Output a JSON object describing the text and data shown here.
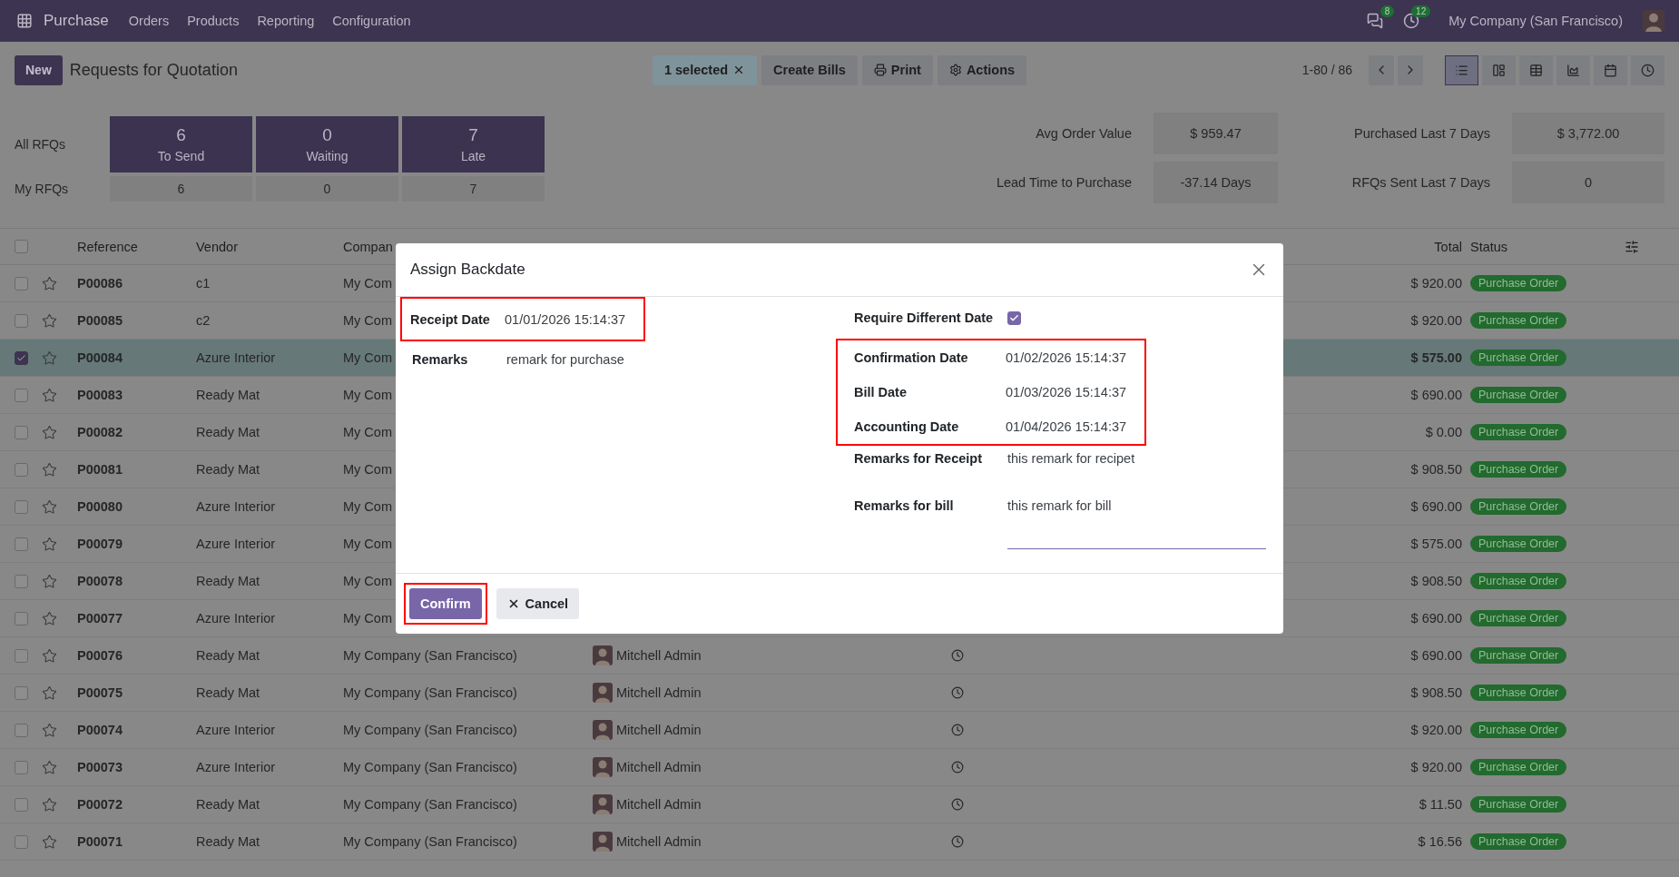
{
  "navbar": {
    "app": "Purchase",
    "menu": [
      "Orders",
      "Products",
      "Reporting",
      "Configuration"
    ],
    "messages_count": "8",
    "activities_count": "12",
    "company": "My Company (San Francisco)"
  },
  "control_panel": {
    "new_button": "New",
    "title": "Requests for Quotation",
    "selection": "1 selected",
    "actions": [
      {
        "kind": "create_bills",
        "label": "Create Bills"
      },
      {
        "kind": "print",
        "label": "Print"
      },
      {
        "kind": "actions",
        "label": "Actions"
      }
    ],
    "pager": "1-80 / 86",
    "views": [
      {
        "kind": "list",
        "selected": true
      },
      {
        "kind": "kanban",
        "selected": false
      },
      {
        "kind": "pivot",
        "selected": false
      },
      {
        "kind": "graph",
        "selected": false
      },
      {
        "kind": "calendar",
        "selected": false
      },
      {
        "kind": "activity",
        "selected": false
      }
    ]
  },
  "dashboard": {
    "all_label": "All RFQs",
    "cards": [
      {
        "value": "6",
        "label": "To Send"
      },
      {
        "value": "0",
        "label": "Waiting"
      },
      {
        "value": "7",
        "label": "Late"
      }
    ],
    "my_label": "My RFQs",
    "my_values": [
      "6",
      "0",
      "7"
    ],
    "kpis": [
      {
        "label": "Avg Order Value",
        "value": "$ 959.47"
      },
      {
        "label": "Purchased Last 7 Days",
        "value": "$ 3,772.00"
      },
      {
        "label": "Lead Time to Purchase",
        "value": "-37.14 Days"
      },
      {
        "label": "RFQs Sent Last 7 Days",
        "value": "0"
      }
    ]
  },
  "table": {
    "all_selected": false,
    "columns": [
      "Reference",
      "Vendor",
      "Compan",
      "Total",
      "Status"
    ],
    "rows": [
      {
        "selected": false,
        "starred": false,
        "reference": "P00086",
        "vendor": "c1",
        "company": "My Com",
        "total": "$ 920.00",
        "status": "Purchase Order"
      },
      {
        "selected": false,
        "starred": false,
        "reference": "P00085",
        "vendor": "c2",
        "company": "My Com",
        "total": "$ 920.00",
        "status": "Purchase Order"
      },
      {
        "selected": true,
        "starred": false,
        "reference": "P00084",
        "vendor": "Azure Interior",
        "company": "My Com",
        "total": "$ 575.00",
        "status": "Purchase Order"
      },
      {
        "selected": false,
        "starred": false,
        "reference": "P00083",
        "vendor": "Ready Mat",
        "company": "My Com",
        "total": "$ 690.00",
        "status": "Purchase Order"
      },
      {
        "selected": false,
        "starred": false,
        "reference": "P00082",
        "vendor": "Ready Mat",
        "company": "My Com",
        "total": "$ 0.00",
        "status": "Purchase Order"
      },
      {
        "selected": false,
        "starred": false,
        "reference": "P00081",
        "vendor": "Ready Mat",
        "company": "My Com",
        "total": "$ 908.50",
        "status": "Purchase Order"
      },
      {
        "selected": false,
        "starred": false,
        "reference": "P00080",
        "vendor": "Azure Interior",
        "company": "My Com",
        "total": "$ 690.00",
        "status": "Purchase Order"
      },
      {
        "selected": false,
        "starred": false,
        "reference": "P00079",
        "vendor": "Azure Interior",
        "company": "My Com",
        "total": "$ 575.00",
        "status": "Purchase Order"
      },
      {
        "selected": false,
        "starred": false,
        "reference": "P00078",
        "vendor": "Ready Mat",
        "company": "My Com",
        "total": "$ 908.50",
        "status": "Purchase Order"
      },
      {
        "selected": false,
        "starred": false,
        "reference": "P00077",
        "vendor": "Azure Interior",
        "company": "My Com",
        "total": "$ 690.00",
        "status": "Purchase Order"
      },
      {
        "selected": false,
        "starred": false,
        "reference": "P00076",
        "vendor": "Ready Mat",
        "company": "My Company (San Francisco)",
        "buyer": "Mitchell Admin",
        "total": "$ 690.00",
        "status": "Purchase Order"
      },
      {
        "selected": false,
        "starred": false,
        "reference": "P00075",
        "vendor": "Ready Mat",
        "company": "My Company (San Francisco)",
        "buyer": "Mitchell Admin",
        "total": "$ 908.50",
        "status": "Purchase Order"
      },
      {
        "selected": false,
        "starred": false,
        "reference": "P00074",
        "vendor": "Azure Interior",
        "company": "My Company (San Francisco)",
        "buyer": "Mitchell Admin",
        "total": "$ 920.00",
        "status": "Purchase Order"
      },
      {
        "selected": false,
        "starred": false,
        "reference": "P00073",
        "vendor": "Azure Interior",
        "company": "My Company (San Francisco)",
        "buyer": "Mitchell Admin",
        "total": "$ 920.00",
        "status": "Purchase Order"
      },
      {
        "selected": false,
        "starred": false,
        "reference": "P00072",
        "vendor": "Ready Mat",
        "company": "My Company (San Francisco)",
        "buyer": "Mitchell Admin",
        "total": "$ 11.50",
        "status": "Purchase Order"
      },
      {
        "selected": false,
        "starred": false,
        "reference": "P00071",
        "vendor": "Ready Mat",
        "company": "My Company (San Francisco)",
        "buyer": "Mitchell Admin",
        "total": "$ 16.56",
        "status": "Purchase Order"
      }
    ]
  },
  "dialog": {
    "title": "Assign Backdate",
    "left_fields": [
      {
        "label": "Receipt Date",
        "value": "01/01/2026 15:14:37",
        "highlighted": true
      },
      {
        "label": "Remarks",
        "value": "remark for purchase",
        "highlighted": false
      }
    ],
    "require_different_date": {
      "label": "Require Different Date",
      "checked": true
    },
    "date_group": {
      "highlighted": true,
      "fields": [
        {
          "label": "Confirmation Date",
          "value": "01/02/2026 15:14:37"
        },
        {
          "label": "Bill Date",
          "value": "01/03/2026 15:14:37"
        },
        {
          "label": "Accounting Date",
          "value": "01/04/2026 15:14:37"
        }
      ]
    },
    "remarks_fields": [
      {
        "label": "Remarks for Receipt",
        "value": "this remark for recipet",
        "focused": false
      },
      {
        "label": "Remarks for bill",
        "value": "this remark for bill",
        "focused": true
      }
    ],
    "buttons": [
      {
        "kind": "primary",
        "label": "Confirm",
        "highlighted": true
      },
      {
        "kind": "secondary",
        "label": "Cancel",
        "highlighted": false
      }
    ]
  }
}
